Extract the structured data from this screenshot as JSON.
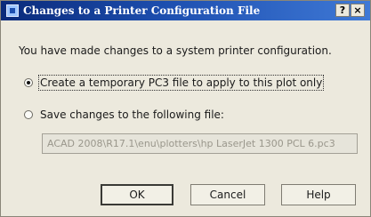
{
  "window": {
    "title": "Changes to a Printer Configuration File",
    "help_glyph": "?",
    "close_glyph": "×"
  },
  "dialog": {
    "prompt": "You have made changes to a system printer configuration.",
    "options": [
      {
        "label": "Create a temporary PC3 file to apply to this plot only",
        "selected": true
      },
      {
        "label": "Save changes to the following file:",
        "selected": false
      }
    ],
    "file_path": "ACAD 2008\\R17.1\\enu\\plotters\\hp LaserJet 1300 PCL 6.pc3",
    "buttons": {
      "ok": "OK",
      "cancel": "Cancel",
      "help": "Help"
    }
  },
  "icons": {
    "title_icon": "dialog-window-icon",
    "help": "question-icon",
    "close": "close-icon"
  }
}
